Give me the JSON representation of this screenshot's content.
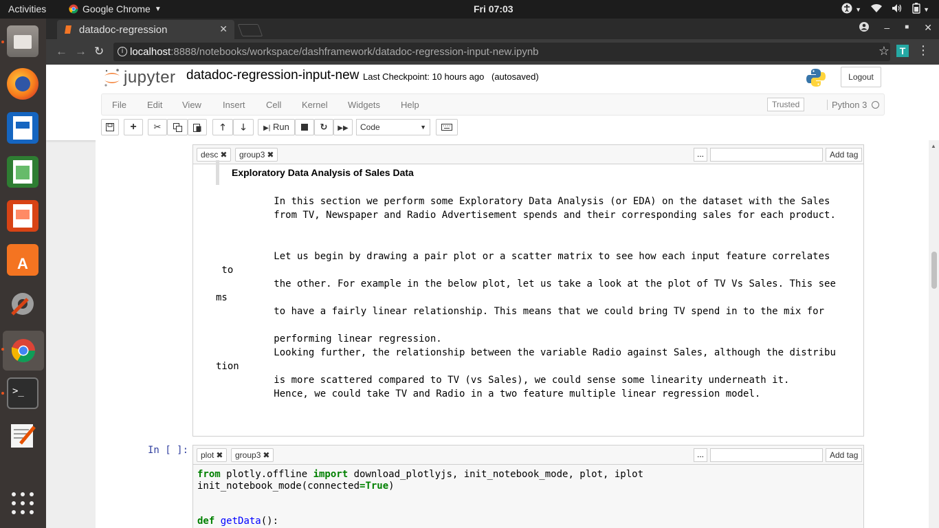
{
  "topbar": {
    "activities": "Activities",
    "app_name": "Google Chrome",
    "clock": "Fri 07:03"
  },
  "browser": {
    "tab_title": "datadoc-regression",
    "url_host": "localhost",
    "url_path": ":8888/notebooks/workspace/dashframework/datadoc-regression-input-new.ipynb",
    "extension_letter": "T"
  },
  "jupyter": {
    "logo_text": "jupyter",
    "notebook_title": "datadoc-regression-input-new",
    "checkpoint": "Last Checkpoint: 10 hours ago",
    "autosaved": "(autosaved)",
    "logout": "Logout",
    "menu": [
      "File",
      "Edit",
      "View",
      "Insert",
      "Cell",
      "Kernel",
      "Widgets",
      "Help"
    ],
    "trusted": "Trusted",
    "kernel": "Python 3",
    "toolbar": {
      "run": "Run",
      "cell_type": "Code"
    }
  },
  "cells": {
    "markdown": {
      "tags": [
        "desc",
        "group3"
      ],
      "add_tag": "Add tag",
      "more": "...",
      "heading": "Exploratory Data Analysis of Sales Data",
      "body": "          In this section we perform some Exploratory Data Analysis (or EDA) on the dataset with the Sales\n          from TV, Newspaper and Radio Advertisement spends and their corresponding sales for each product.\n\n\n          Let us begin by drawing a pair plot or a scatter matrix to see how each input feature correlates\n to\n          the other. For example in the below plot, let us take a look at the plot of TV Vs Sales. This see\nms\n          to have a fairly linear relationship. This means that we could bring TV spend in to the mix for\n\n          performing linear regression.\n          Looking further, the relationship between the variable Radio against Sales, although the distribu\ntion\n          is more scattered compared to TV (vs Sales), we could sense some linearity underneath it.\n          Hence, we could take TV and Radio in a two feature multiple linear regression model."
    },
    "code": {
      "prompt": "In [ ]:",
      "tags": [
        "plot",
        "group3"
      ],
      "add_tag": "Add tag",
      "more": "...",
      "line1": {
        "kw_from": "from",
        "module": " plotly.offline ",
        "kw_import": "import",
        "names": " download_plotlyjs, init_notebook_mode, plot, iplot"
      },
      "line2": {
        "call": "init_notebook_mode(connected",
        "eq": "=",
        "val": "True",
        "close": ")"
      },
      "line3": {
        "kw_def": "def",
        "fname": "getData",
        "rest": "():"
      }
    }
  },
  "icons": {
    "tray": [
      "accessibility-icon",
      "wifi-icon",
      "volume-icon",
      "battery-icon",
      "power-icon"
    ]
  }
}
